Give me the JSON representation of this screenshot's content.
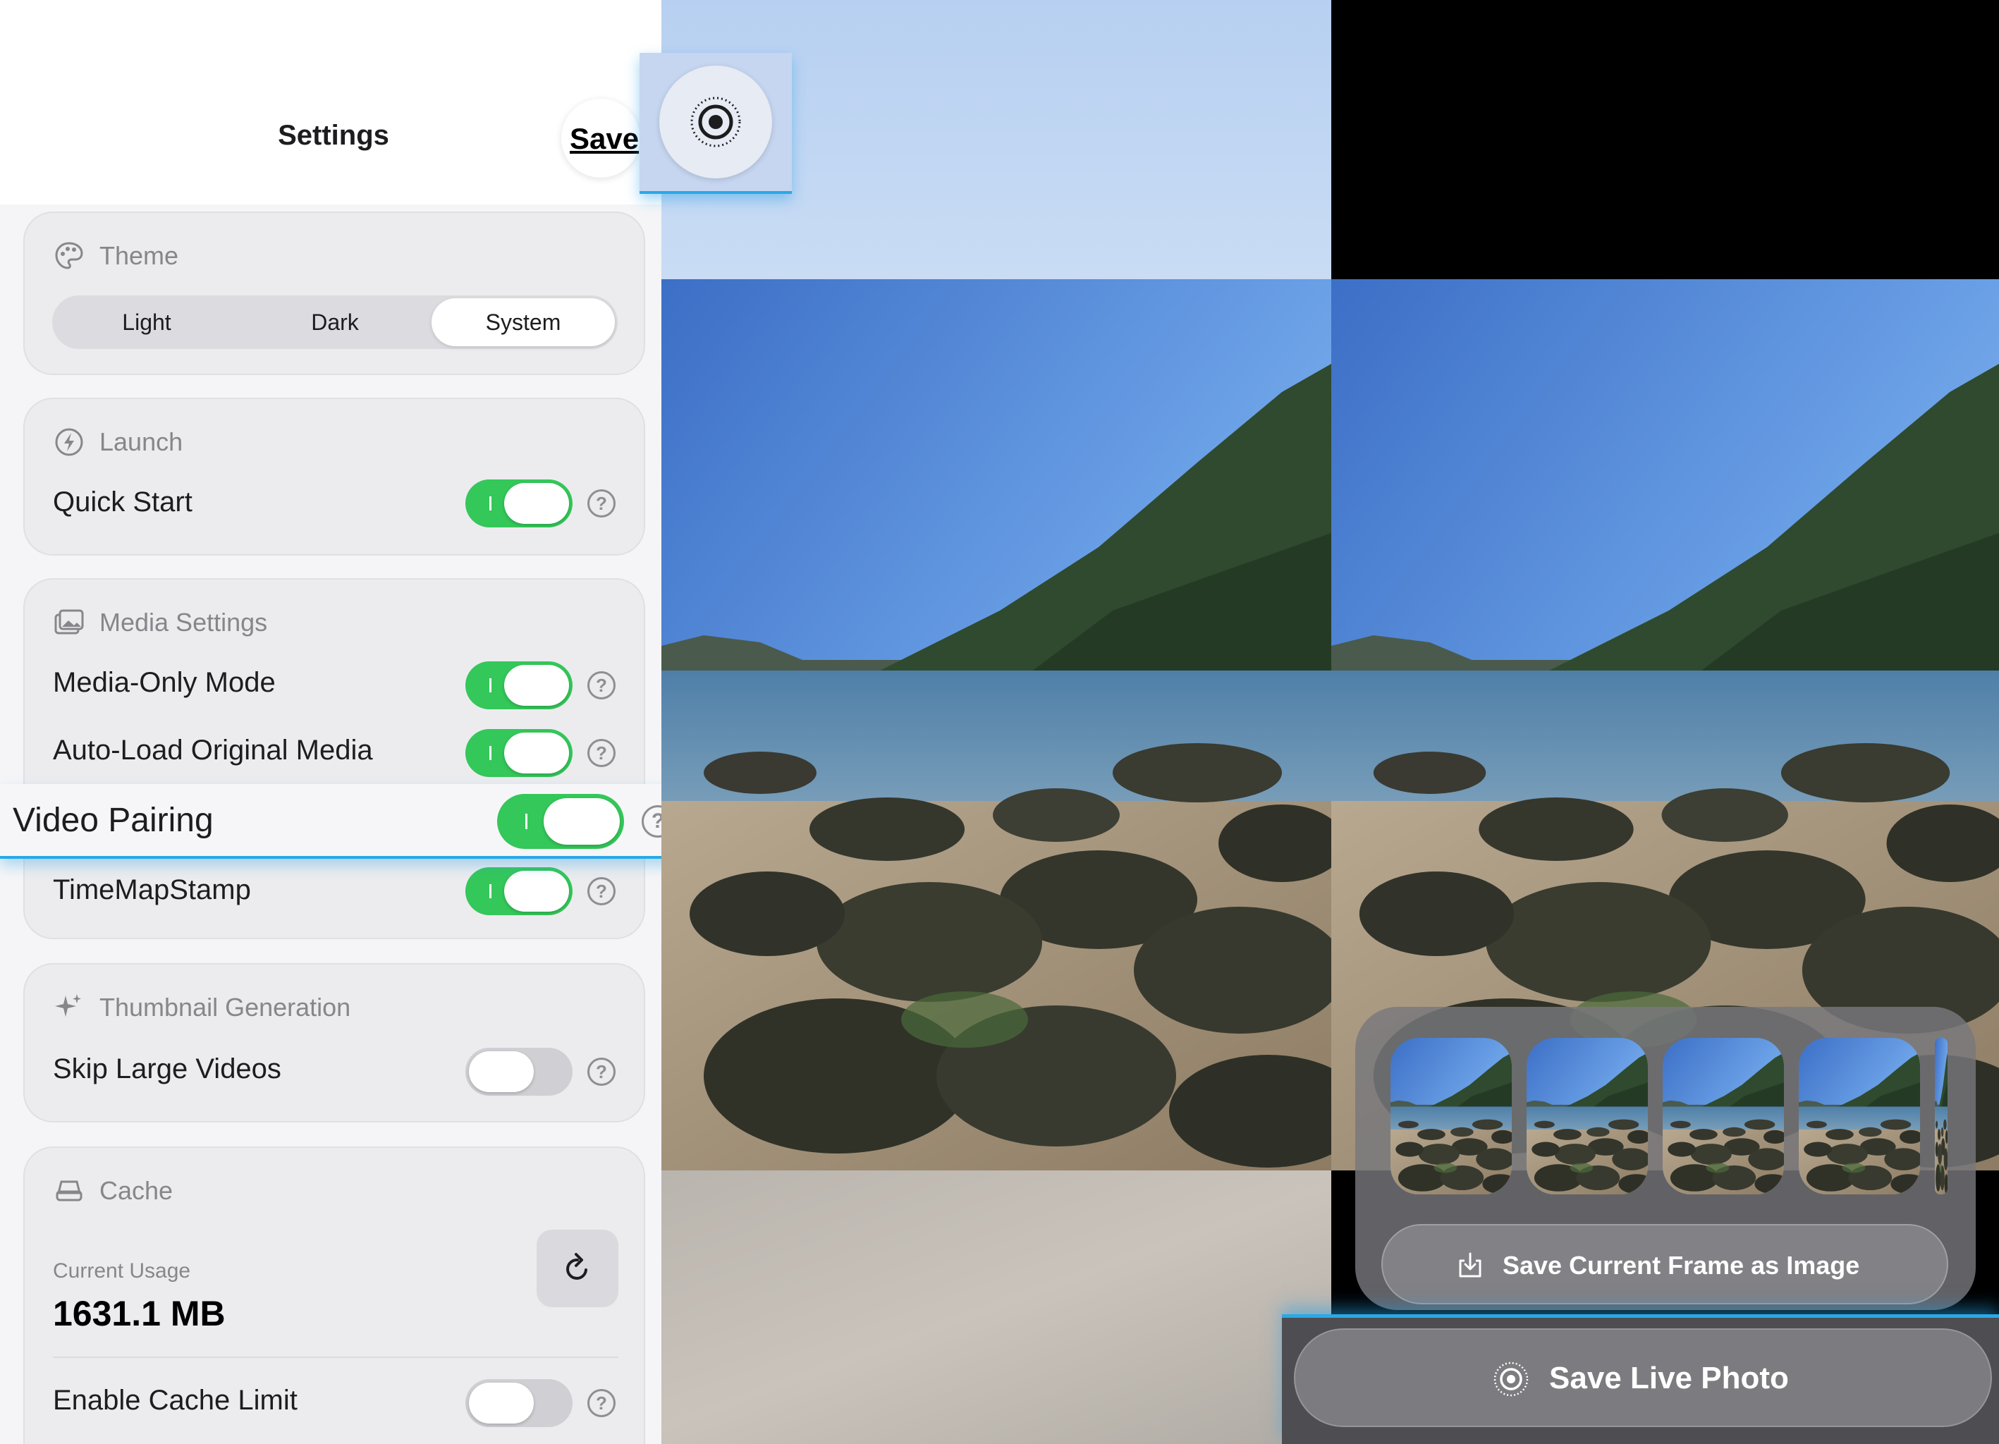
{
  "header": {
    "title": "Settings",
    "save_label": "Save"
  },
  "theme": {
    "header": "Theme",
    "options": [
      "Light",
      "Dark",
      "System"
    ],
    "selected": "System"
  },
  "launch": {
    "header": "Launch",
    "quick_start": {
      "label": "Quick Start",
      "enabled": true
    }
  },
  "media": {
    "header": "Media Settings",
    "media_only": {
      "label": "Media-Only Mode",
      "enabled": true
    },
    "auto_load": {
      "label": "Auto-Load Original Media",
      "enabled": true
    },
    "video_pairing": {
      "label": "Video Pairing",
      "enabled": true
    },
    "timemapstamp": {
      "label": "TimeMapStamp",
      "enabled": true
    }
  },
  "thumbnail": {
    "header": "Thumbnail Generation",
    "skip_large": {
      "label": "Skip Large Videos",
      "enabled": false
    }
  },
  "cache": {
    "header": "Cache",
    "usage_label": "Current Usage",
    "usage_value": "1631.1 MB",
    "limit": {
      "label": "Enable Cache Limit",
      "enabled": false
    }
  },
  "help_glyph": "?",
  "viewer": {
    "save_frame_label": "Save Current Frame as Image",
    "save_live_label": "Save Live Photo",
    "frame_thumbnail_count": 4
  },
  "colors": {
    "accent_green": "#34c759",
    "highlight_blue": "#2aa8e8"
  },
  "icons": [
    "palette-icon",
    "bolt-icon",
    "photos-icon",
    "sparkles-icon",
    "drive-icon",
    "refresh-icon",
    "live-photo-icon",
    "download-icon",
    "help-icon"
  ]
}
